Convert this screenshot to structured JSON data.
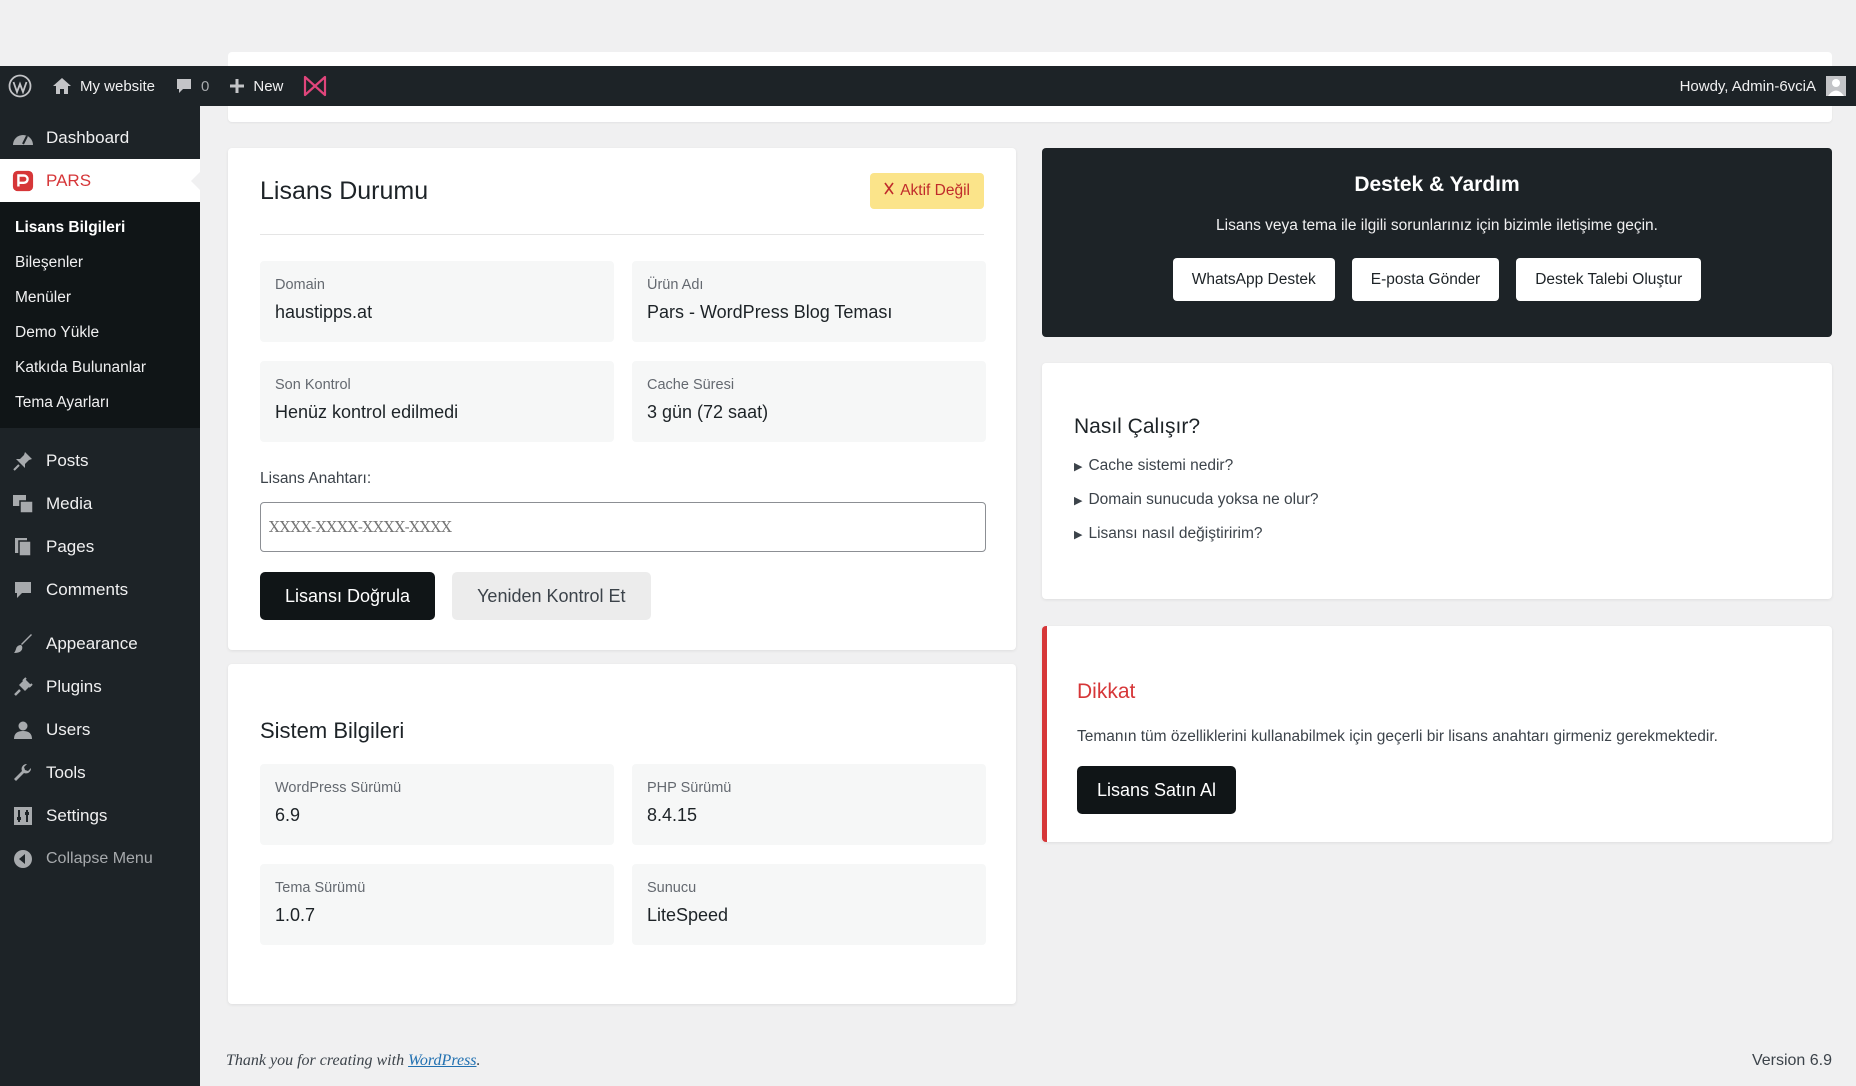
{
  "adminbar": {
    "site_name": "My website",
    "comments_count": "0",
    "new_label": "New",
    "howdy": "Howdy, Admin-6vciA"
  },
  "sidebar": {
    "dashboard": "Dashboard",
    "pars": "PARS",
    "submenu": [
      "Lisans Bilgileri",
      "Bileşenler",
      "Menüler",
      "Demo Yükle",
      "Katkıda Bulunanlar",
      "Tema Ayarları"
    ],
    "posts": "Posts",
    "media": "Media",
    "pages": "Pages",
    "comments": "Comments",
    "appearance": "Appearance",
    "plugins": "Plugins",
    "users": "Users",
    "tools": "Tools",
    "settings": "Settings",
    "collapse": "Collapse Menu"
  },
  "license": {
    "title": "Lisans Durumu",
    "status_badge": "Aktif Değil",
    "badge_color": "#fbe48a",
    "fields": [
      {
        "label": "Domain",
        "value": "haustipps.at"
      },
      {
        "label": "Ürün Adı",
        "value": "Pars - WordPress Blog Teması"
      },
      {
        "label": "Son Kontrol",
        "value": "Henüz kontrol edilmedi"
      },
      {
        "label": "Cache Süresi",
        "value": "3 gün (72 saat)"
      }
    ],
    "key_label": "Lisans Anahtarı:",
    "key_placeholder": "XXXX-XXXX-XXXX-XXXX",
    "verify_button": "Lisansı Doğrula",
    "recheck_button": "Yeniden Kontrol Et"
  },
  "system": {
    "title": "Sistem Bilgileri",
    "fields": [
      {
        "label": "WordPress Sürümü",
        "value": "6.9"
      },
      {
        "label": "PHP Sürümü",
        "value": "8.4.15"
      },
      {
        "label": "Tema Sürümü",
        "value": "1.0.7"
      },
      {
        "label": "Sunucu",
        "value": "LiteSpeed"
      }
    ]
  },
  "support": {
    "title": "Destek & Yardım",
    "text": "Lisans veya tema ile ilgili sorunlarınız için bizimle iletişime geçin.",
    "whatsapp": "WhatsApp Destek",
    "email": "E-posta Gönder",
    "ticket": "Destek Talebi Oluştur"
  },
  "how": {
    "title": "Nasıl Çalışır?",
    "faqs": [
      "Cache sistemi nedir?",
      "Domain sunucuda yoksa ne olur?",
      "Lisansı nasıl değiştiririm?"
    ]
  },
  "warning": {
    "title": "Dikkat",
    "text": "Temanın tüm özelliklerini kullanabilmek için geçerli bir lisans anahtarı girmeniz gerekmektedir.",
    "buy_button": "Lisans Satın Al",
    "accent": "#d63638"
  },
  "footer": {
    "thanks_prefix": "Thank you for creating with ",
    "wordpress_link": "WordPress",
    "thanks_suffix": ".",
    "version": "Version 6.9"
  }
}
